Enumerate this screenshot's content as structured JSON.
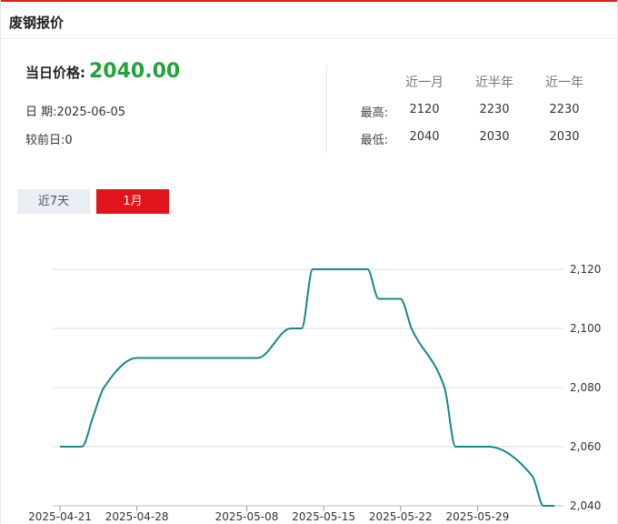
{
  "header": {
    "title": "废钢报价"
  },
  "price": {
    "label": "当日价格:",
    "value": "2040.00"
  },
  "date": {
    "label": "日 期:",
    "value": "2025-06-05"
  },
  "change": {
    "label": "较前日:",
    "value": "0"
  },
  "stats": {
    "columns": [
      "近一月",
      "近半年",
      "近一年"
    ],
    "rows": [
      {
        "label": "最高:",
        "values": [
          "2120",
          "2230",
          "2230"
        ]
      },
      {
        "label": "最低:",
        "values": [
          "2040",
          "2030",
          "2030"
        ]
      }
    ]
  },
  "tabs": [
    {
      "label": "近7天",
      "active": false
    },
    {
      "label": "1月",
      "active": true
    }
  ],
  "colors": {
    "accent": "#e1141b",
    "price": "#22a33a",
    "line": "#138a8a"
  },
  "chart_data": {
    "type": "line",
    "title": "",
    "xlabel": "",
    "ylabel": "",
    "x_ticks": [
      "2025-04-21",
      "2025-04-28",
      "2025-05-08",
      "2025-05-15",
      "2025-05-22",
      "2025-05-29"
    ],
    "y_ticks": [
      "2,040",
      "2,060",
      "2,080",
      "2,100",
      "2,120"
    ],
    "ylim": [
      2040,
      2120
    ],
    "y_axis_position": "right",
    "grid": true,
    "series": [
      {
        "x": [
          "2025-04-21",
          "2025-04-22",
          "2025-04-23",
          "2025-04-24",
          "2025-04-25",
          "2025-04-28",
          "2025-04-29",
          "2025-04-30",
          "2025-05-06",
          "2025-05-07",
          "2025-05-08",
          "2025-05-09",
          "2025-05-12",
          "2025-05-13",
          "2025-05-14",
          "2025-05-15",
          "2025-05-16",
          "2025-05-19",
          "2025-05-20",
          "2025-05-21",
          "2025-05-22",
          "2025-05-23",
          "2025-05-26",
          "2025-05-27",
          "2025-05-28",
          "2025-05-29",
          "2025-05-30",
          "2025-06-03",
          "2025-06-04",
          "2025-06-05"
        ],
        "values": [
          2060,
          2060,
          2060,
          2070,
          2080,
          2090,
          2090,
          2090,
          2090,
          2090,
          2090,
          2090,
          2100,
          2100,
          2120,
          2120,
          2120,
          2120,
          2110,
          2110,
          2110,
          2100,
          2080,
          2060,
          2060,
          2060,
          2060,
          2050,
          2040,
          2040
        ]
      }
    ]
  }
}
